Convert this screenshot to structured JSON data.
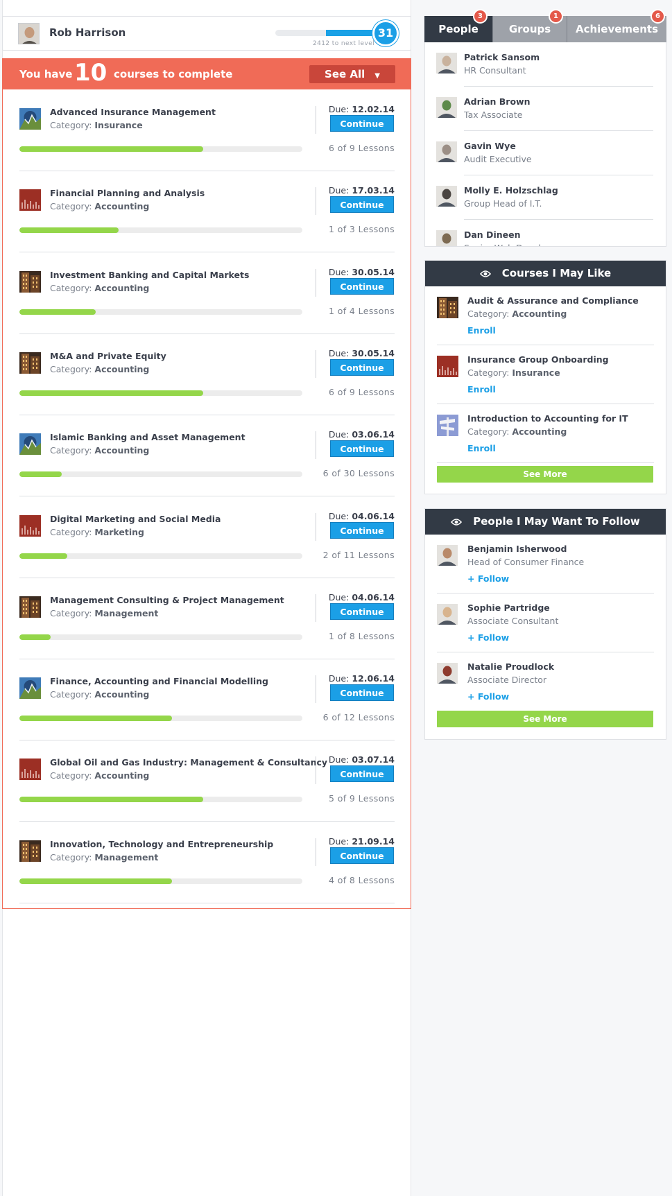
{
  "user": {
    "name": "Rob Harrison",
    "level": "31",
    "next_level_text": "2412 to next level",
    "level_progress": 0.53
  },
  "courses_header": {
    "prefix": "You have",
    "count": "10",
    "suffix": "courses to complete",
    "see_all": "See All",
    "see_all_arrow": "▼"
  },
  "course_button": "Continue",
  "due_label": "Due:",
  "category_label": "Category:",
  "courses": [
    {
      "title": "Advanced Insurance Management",
      "category": "Insurance",
      "due": "12.02.14",
      "lessons": "6 of 9 Lessons",
      "progress": 0.65,
      "thumb": "mountain"
    },
    {
      "title": "Financial Planning and Analysis",
      "category": "Accounting",
      "due": "17.03.14",
      "lessons": "1 of 3 Lessons",
      "progress": 0.35,
      "thumb": "red"
    },
    {
      "title": "Investment Banking and Capital Markets",
      "category": "Accounting",
      "due": "30.05.14",
      "lessons": "1 of 4 Lessons",
      "progress": 0.27,
      "thumb": "building"
    },
    {
      "title": "M&A and Private Equity",
      "category": "Accounting",
      "due": "30.05.14",
      "lessons": "6 of 9 Lessons",
      "progress": 0.65,
      "thumb": "building"
    },
    {
      "title": "Islamic Banking and Asset Management",
      "category": "Accounting",
      "due": "03.06.14",
      "lessons": "6 of 30 Lessons",
      "progress": 0.15,
      "thumb": "mountain"
    },
    {
      "title": "Digital Marketing and Social Media",
      "category": "Marketing",
      "due": "04.06.14",
      "lessons": "2 of 11 Lessons",
      "progress": 0.17,
      "thumb": "red"
    },
    {
      "title": "Management Consulting & Project Management",
      "category": "Management",
      "due": "04.06.14",
      "lessons": "1 of 8 Lessons",
      "progress": 0.11,
      "thumb": "building"
    },
    {
      "title": "Finance, Accounting and Financial Modelling",
      "category": "Accounting",
      "due": "12.06.14",
      "lessons": "6 of 12 Lessons",
      "progress": 0.54,
      "thumb": "mountain"
    },
    {
      "title": "Global Oil and Gas Industry: Management & Consultancy",
      "category": "Accounting",
      "due": "03.07.14",
      "lessons": "5 of 9 Lessons",
      "progress": 0.65,
      "thumb": "red"
    },
    {
      "title": "Innovation, Technology and Entrepreneurship",
      "category": "Management",
      "due": "21.09.14",
      "lessons": "4 of 8 Lessons",
      "progress": 0.54,
      "thumb": "building"
    }
  ],
  "tabs": [
    {
      "label": "People",
      "badge": "3"
    },
    {
      "label": "Groups",
      "badge": "1"
    },
    {
      "label": "Achievements",
      "badge": "6"
    }
  ],
  "people": [
    {
      "name": "Patrick Sansom",
      "role": "HR Consultant",
      "tone": "#c9b29d"
    },
    {
      "name": "Adrian Brown",
      "role": "Tax Associate",
      "tone": "#5d8a4a"
    },
    {
      "name": "Gavin Wye",
      "role": "Audit Executive",
      "tone": "#9c8f86"
    },
    {
      "name": "Molly E. Holzschlag",
      "role": "Group Head of I.T.",
      "tone": "#4a4541"
    },
    {
      "name": "Dan Dineen",
      "role": "Senior Web Developer",
      "tone": "#7d6a52"
    }
  ],
  "courses_like": {
    "title": "Courses I May Like",
    "action": "Enroll",
    "see_more": "See More",
    "items": [
      {
        "title": "Audit & Assurance and Compliance",
        "category": "Accounting",
        "thumb": "building"
      },
      {
        "title": "Insurance Group Onboarding",
        "category": "Insurance",
        "thumb": "red"
      },
      {
        "title": "Introduction to Accounting for IT",
        "category": "Accounting",
        "thumb": "sign"
      }
    ]
  },
  "follow": {
    "title": "People I May Want To Follow",
    "action": "+ Follow",
    "see_more": "See More",
    "items": [
      {
        "name": "Benjamin Isherwood",
        "role": "Head of Consumer Finance",
        "tone": "#b98a6a"
      },
      {
        "name": "Sophie Partridge",
        "role": "Associate Consultant",
        "tone": "#d8b48e"
      },
      {
        "name": "Natalie Proudlock",
        "role": "Associate Director",
        "tone": "#8e3b2e"
      }
    ]
  },
  "colors": {
    "accent_blue": "#1b9fe6",
    "coral": "#f06b57",
    "green": "#94d64a",
    "dark": "#323a45"
  }
}
